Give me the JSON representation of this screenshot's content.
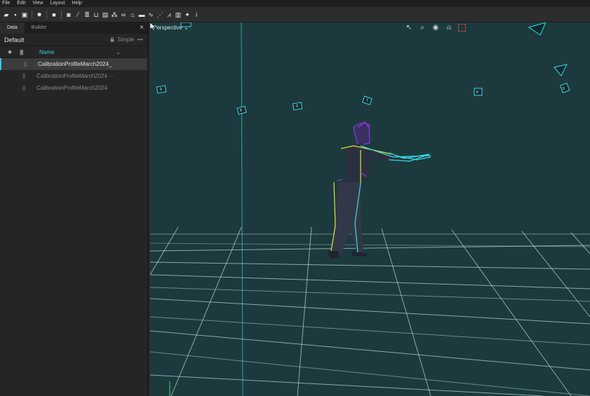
{
  "menu": [
    "File",
    "Edit",
    "View",
    "Layout",
    "Help"
  ],
  "toolbar_icons": [
    "folder-open-icon",
    "save-icon",
    "save-all-icon",
    "gear-icon",
    "rectangle-icon",
    "camera-icon",
    "wand-icon",
    "database-icon",
    "basket-icon",
    "filter-icon",
    "network-icon",
    "link-icon",
    "tag-icon",
    "graph-icon",
    "graph-alt-icon",
    "mountains-icon",
    "export-icon",
    "sparkle-icon",
    "info-icon"
  ],
  "panel": {
    "tabs": [
      {
        "label": "Data"
      },
      {
        "label": "Builder"
      }
    ],
    "close": "×",
    "preset": "Default",
    "mode": "Simple",
    "more": "•••",
    "columns": {
      "name": "Name"
    },
    "rows": [
      {
        "name": "CalibrationProfileMarch2024_",
        "more": "···"
      },
      {
        "name": "CalibrationProfileMarch2024",
        "more": "···"
      },
      {
        "name": "CalibrationProfileMarch2024",
        "more": ""
      }
    ]
  },
  "viewport": {
    "view_mode": "Perspective ⌄",
    "background": "#1c3a3d",
    "grid_color": "#b8d8d8",
    "marker_ids": [
      "9",
      "8",
      "0",
      "7",
      "6",
      "5"
    ]
  },
  "colors": {
    "accent": "#3cc8e0",
    "skeleton_yellow": "#d8e83a",
    "skeleton_cyan": "#3cd8e8",
    "skeleton_purple": "#8a3ad8"
  }
}
